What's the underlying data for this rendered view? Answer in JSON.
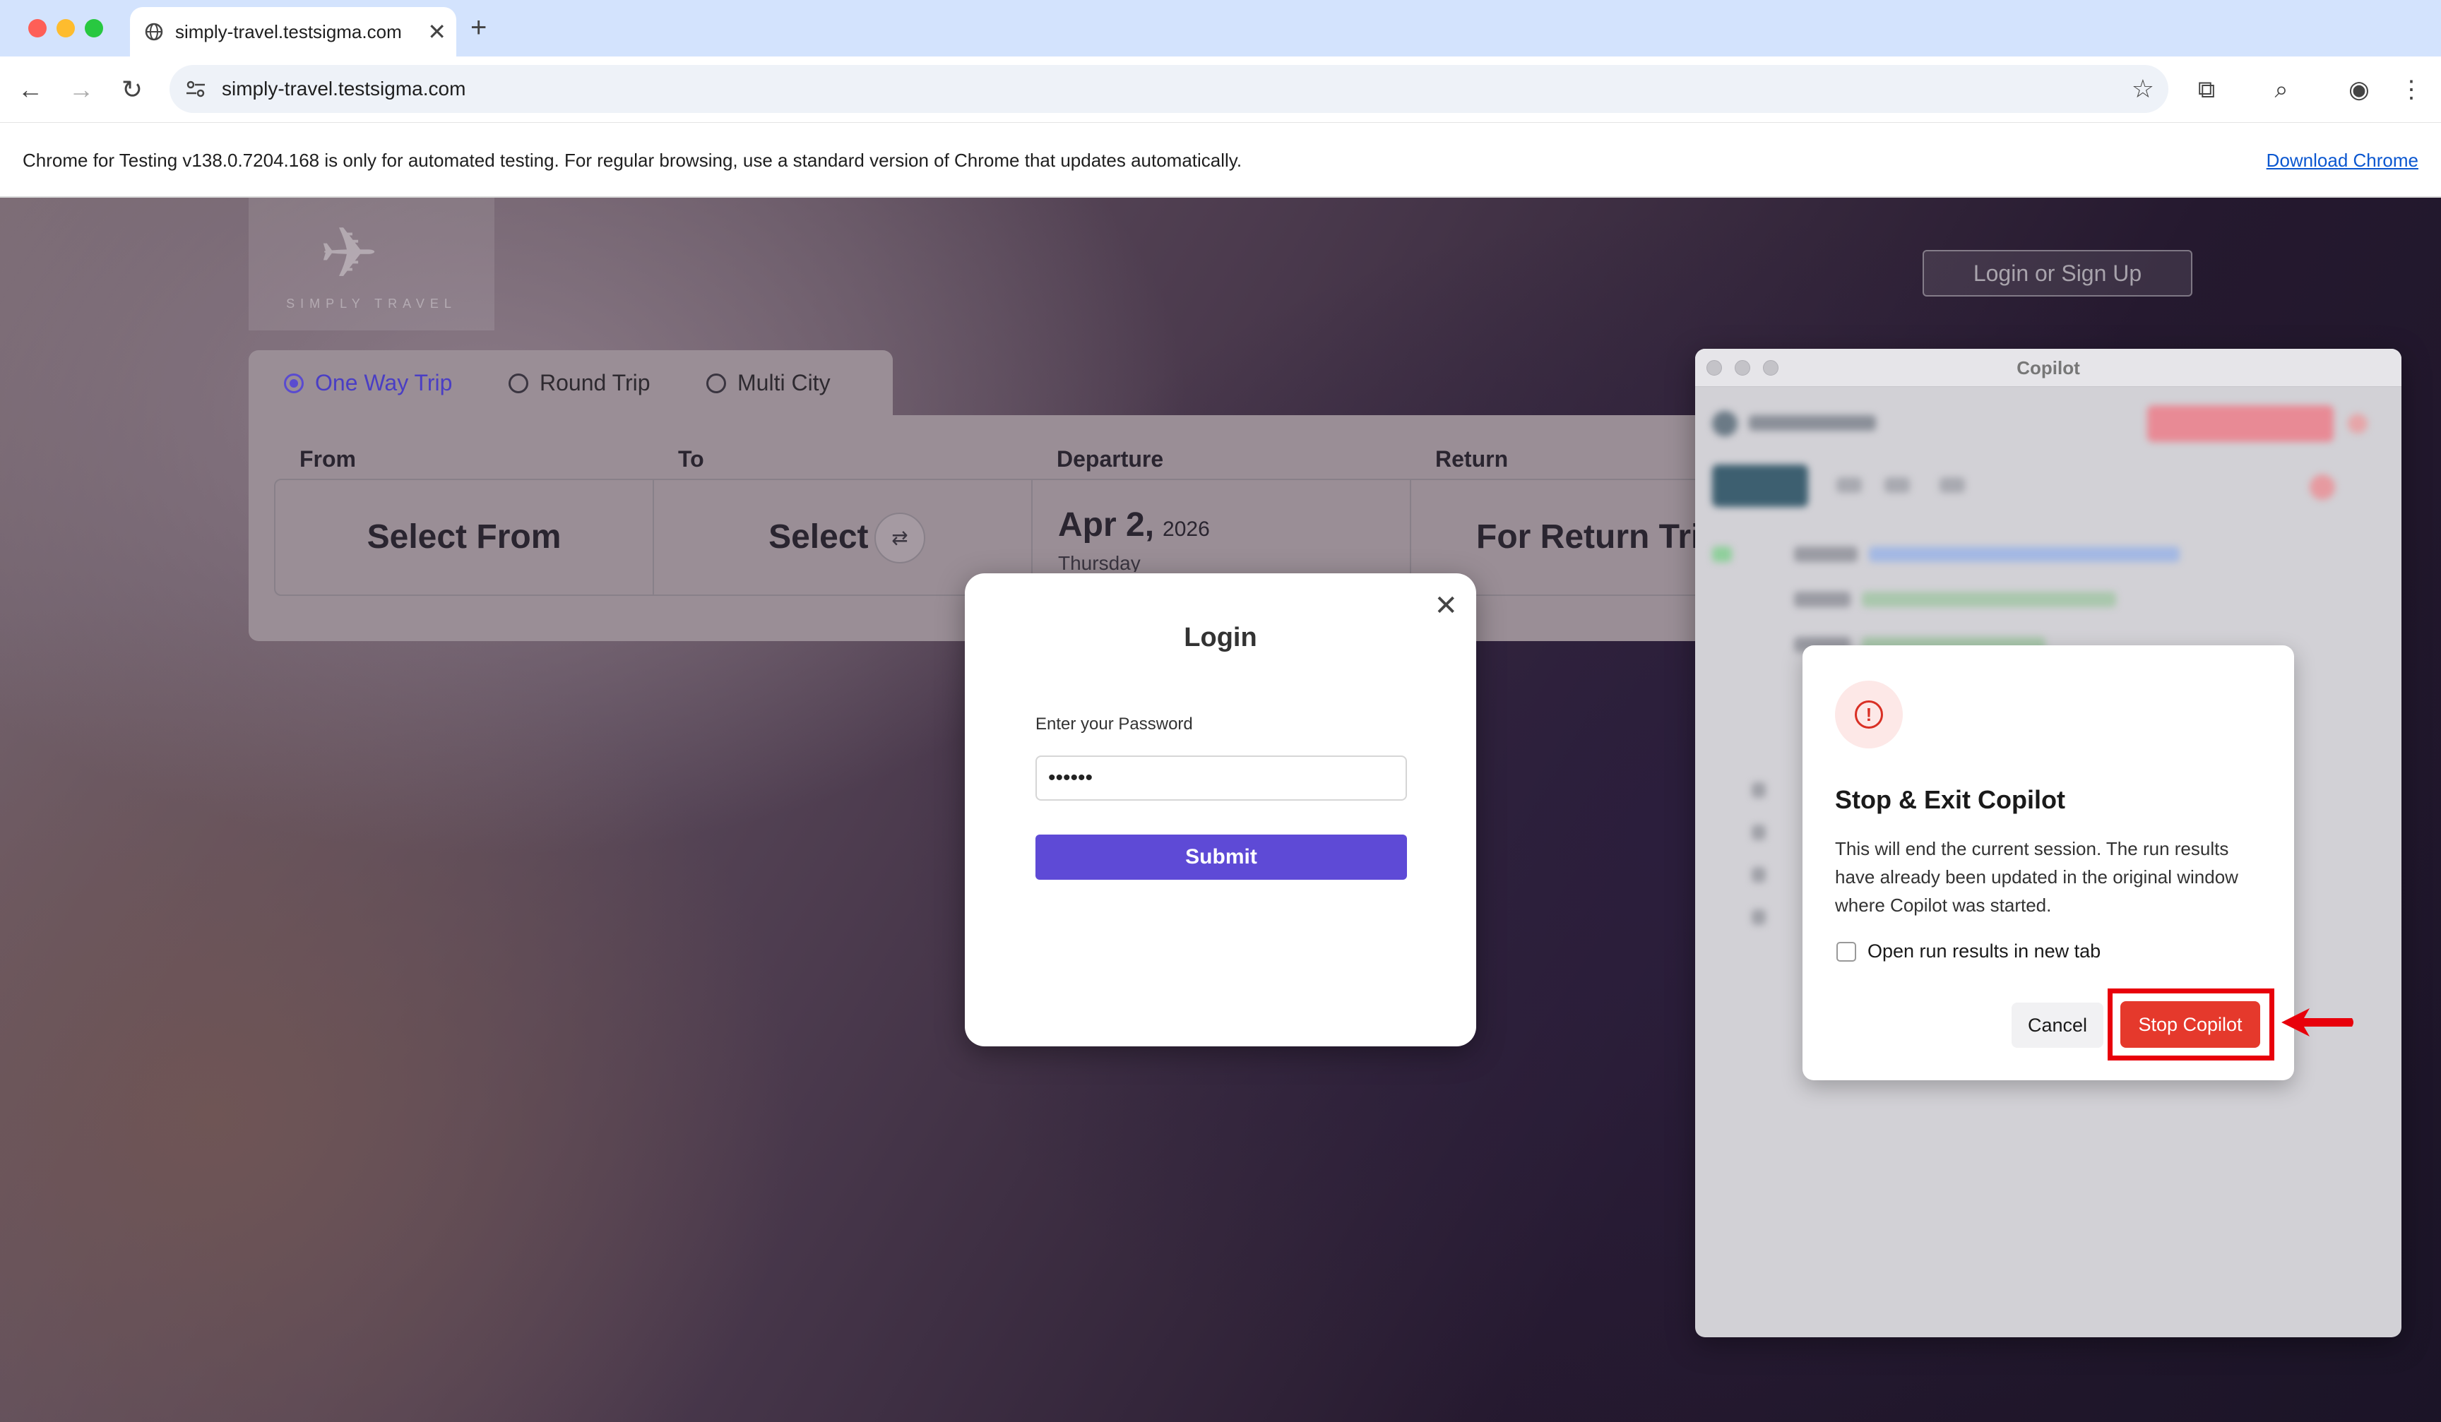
{
  "browser": {
    "tab_title": "simply-travel.testsigma.com",
    "tab_close": "✕",
    "new_tab": "+",
    "url": "simply-travel.testsigma.com",
    "infobar_text": "Chrome for Testing v138.0.7204.168 is only for automated testing. For regular browsing, use a standard version of Chrome that updates automatically.",
    "infobar_link": "Download Chrome"
  },
  "site": {
    "login_signup": "Login or Sign Up",
    "trip_types": [
      "One Way Trip",
      "Round Trip",
      "Multi City"
    ],
    "selected_trip": "One Way Trip",
    "fields": {
      "from_label": "From",
      "to_label": "To",
      "departure_label": "Departure",
      "return_label": "Return",
      "from_value": "Select From",
      "to_value": "Select To",
      "departure_date": "Apr 2,",
      "departure_year": "2026",
      "departure_day": "Thursday",
      "return_value": "For Return Tri"
    }
  },
  "login_modal": {
    "title": "Login",
    "close": "✕",
    "password_label": "Enter your Password",
    "password_value": "••••••",
    "submit": "Submit"
  },
  "copilot": {
    "window_title": "Copilot",
    "dialog": {
      "title": "Stop & Exit Copilot",
      "description": "This will end the current session. The run results have already been updated in the original window where Copilot was started.",
      "checkbox_label": "Open run results in new tab",
      "checkbox_checked": false,
      "cancel": "Cancel",
      "stop": "Stop Copilot"
    }
  },
  "colors": {
    "accent_purple": "#5e4ad6",
    "danger_red": "#e5392c",
    "highlight_red": "#e8000b"
  }
}
